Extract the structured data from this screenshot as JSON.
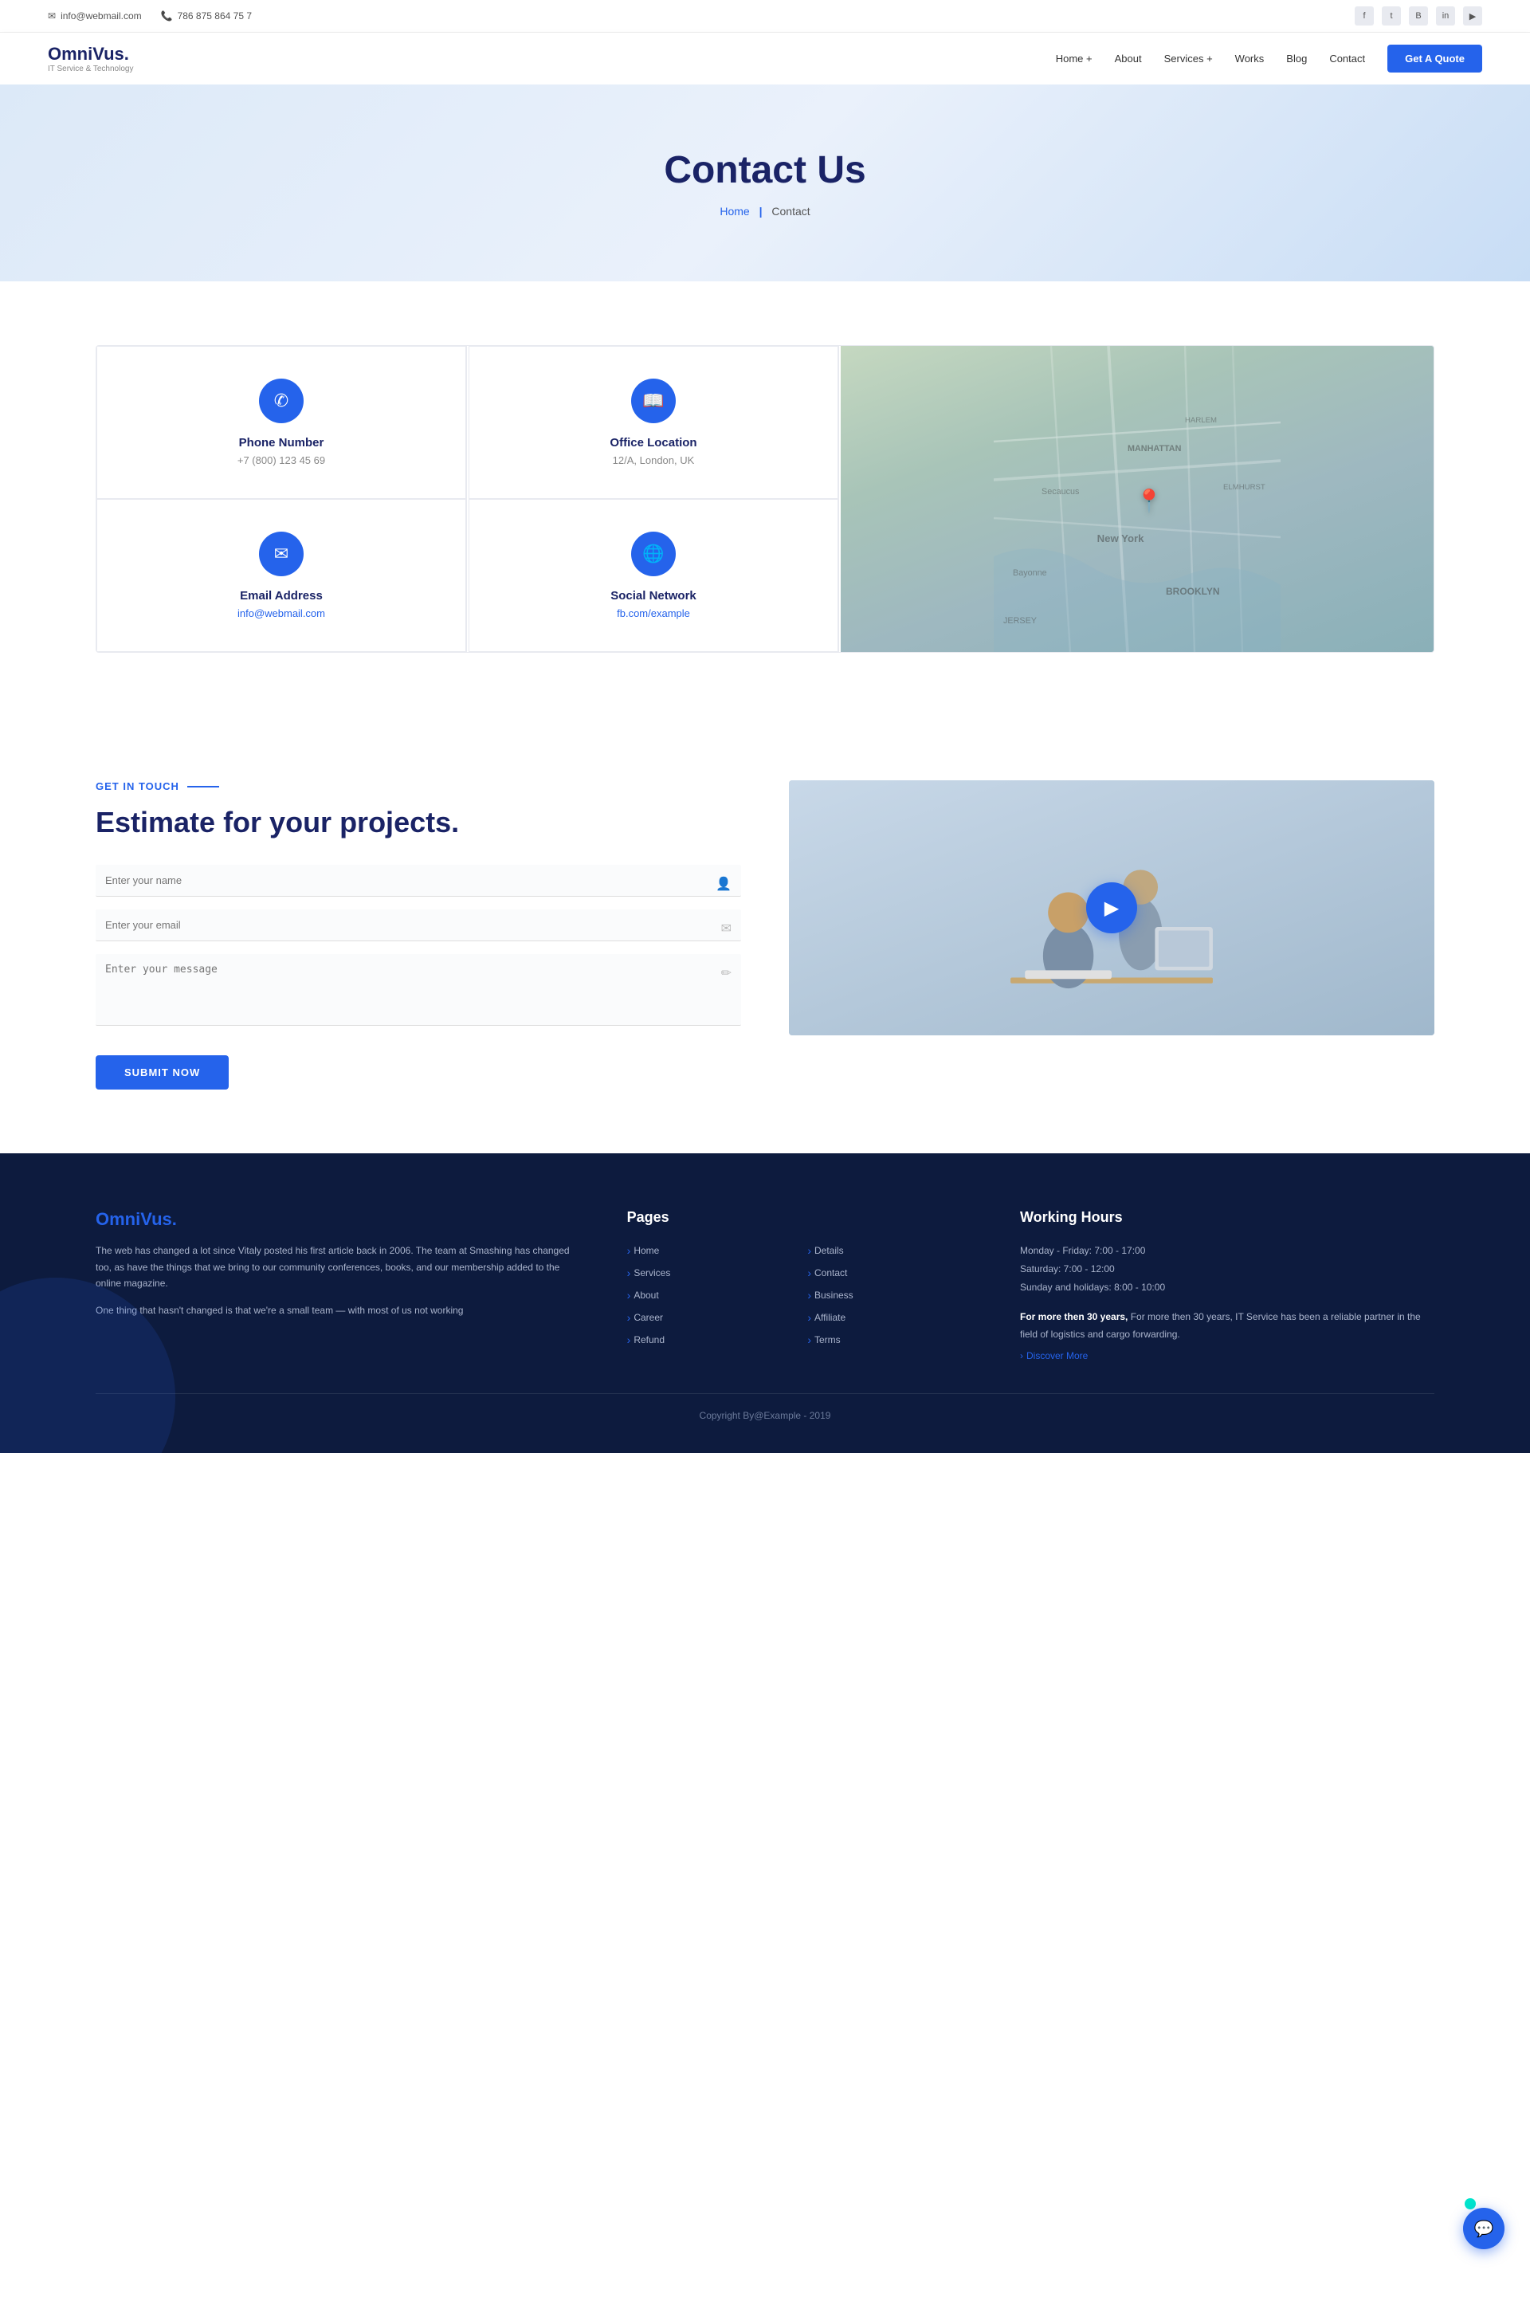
{
  "topbar": {
    "email_icon": "✉",
    "email": "info@webmail.com",
    "phone_icon": "📞",
    "phone": "786 875 864 75 7",
    "social": [
      {
        "name": "facebook",
        "icon": "f"
      },
      {
        "name": "twitter",
        "icon": "t"
      },
      {
        "name": "blogger",
        "icon": "B"
      },
      {
        "name": "linkedin",
        "icon": "in"
      },
      {
        "name": "youtube",
        "icon": "▶"
      }
    ]
  },
  "navbar": {
    "logo_name": "OmniVus.",
    "logo_sub": "IT Service & Technology",
    "links": [
      {
        "label": "Home +",
        "href": "#"
      },
      {
        "label": "About",
        "href": "#"
      },
      {
        "label": "Services +",
        "href": "#"
      },
      {
        "label": "Works",
        "href": "#"
      },
      {
        "label": "Blog",
        "href": "#"
      },
      {
        "label": "Contact",
        "href": "#"
      }
    ],
    "cta_label": "Get A Quote"
  },
  "hero": {
    "title": "Contact Us",
    "breadcrumb_home": "Home",
    "breadcrumb_sep": "|",
    "breadcrumb_current": "Contact"
  },
  "contact_cards": [
    {
      "icon": "📞",
      "title": "Phone Number",
      "value": "+7 (800) 123 45 69"
    },
    {
      "icon": "✉",
      "title": "Email Address",
      "value": "info@webmail.com"
    },
    {
      "icon": "📖",
      "title": "Office Location",
      "value": "12/A, London, UK"
    },
    {
      "icon": "🌐",
      "title": "Social Network",
      "value": "fb.com/example"
    }
  ],
  "map": {
    "label": "New York"
  },
  "estimate": {
    "tag": "Get In Touch",
    "title": "Estimate for your projects.",
    "form": {
      "name_placeholder": "Enter your name",
      "email_placeholder": "Enter your email",
      "message_placeholder": "Enter your message",
      "submit_label": "Submit Now"
    }
  },
  "footer": {
    "brand_name": "OmniVus.",
    "brand_desc1": "The web has changed a lot since Vitaly posted his first article back in 2006. The team at Smashing has changed too, as have the things that we bring to our community conferences, books, and our membership added to the online magazine.",
    "brand_desc2": "One thing that hasn't changed is that we're a small team — with most of us not working",
    "pages_title": "Pages",
    "pages": [
      {
        "label": "Home",
        "href": "#"
      },
      {
        "label": "Details",
        "href": "#"
      },
      {
        "label": "Services",
        "href": "#"
      },
      {
        "label": "Contact",
        "href": "#"
      },
      {
        "label": "About",
        "href": "#"
      },
      {
        "label": "Business",
        "href": "#"
      },
      {
        "label": "Career",
        "href": "#"
      },
      {
        "label": "Affiliate",
        "href": "#"
      },
      {
        "label": "Refund",
        "href": "#"
      },
      {
        "label": "Terms",
        "href": "#"
      }
    ],
    "hours_title": "Working Hours",
    "hours": [
      "Monday - Friday: 7:00 - 17:00",
      "Saturday: 7:00 - 12:00",
      "Sunday and holidays: 8:00 - 10:00"
    ],
    "hours_desc": "For more then 30 years, IT Service has been a reliable partner in the field of logistics and cargo forwarding.",
    "discover_link": "Discover More",
    "copyright": "Copyright By@Example - 2019"
  }
}
